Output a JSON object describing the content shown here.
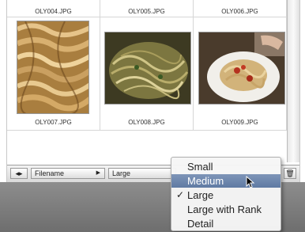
{
  "grid": {
    "top_row": [
      {
        "filename": "OLY004.JPG"
      },
      {
        "filename": "OLY005.JPG"
      },
      {
        "filename": "OLY006.JPG"
      }
    ],
    "bottom_row": [
      {
        "filename": "OLY007.JPG"
      },
      {
        "filename": "OLY008.JPG"
      },
      {
        "filename": "OLY009.JPG"
      }
    ]
  },
  "toolbar": {
    "sort_label": "Filename",
    "view_label": "Large"
  },
  "view_menu": {
    "items": [
      {
        "label": "Small",
        "checked": false,
        "highlighted": false
      },
      {
        "label": "Medium",
        "checked": false,
        "highlighted": true
      },
      {
        "label": "Large",
        "checked": true,
        "highlighted": false
      },
      {
        "label": "Large with Rank",
        "checked": false,
        "highlighted": false
      },
      {
        "label": "Detail",
        "checked": false,
        "highlighted": false
      }
    ],
    "check_glyph": "✓"
  },
  "colors": {
    "highlight": "#6a84ad",
    "desktop_gray": "#7c7c7c"
  }
}
